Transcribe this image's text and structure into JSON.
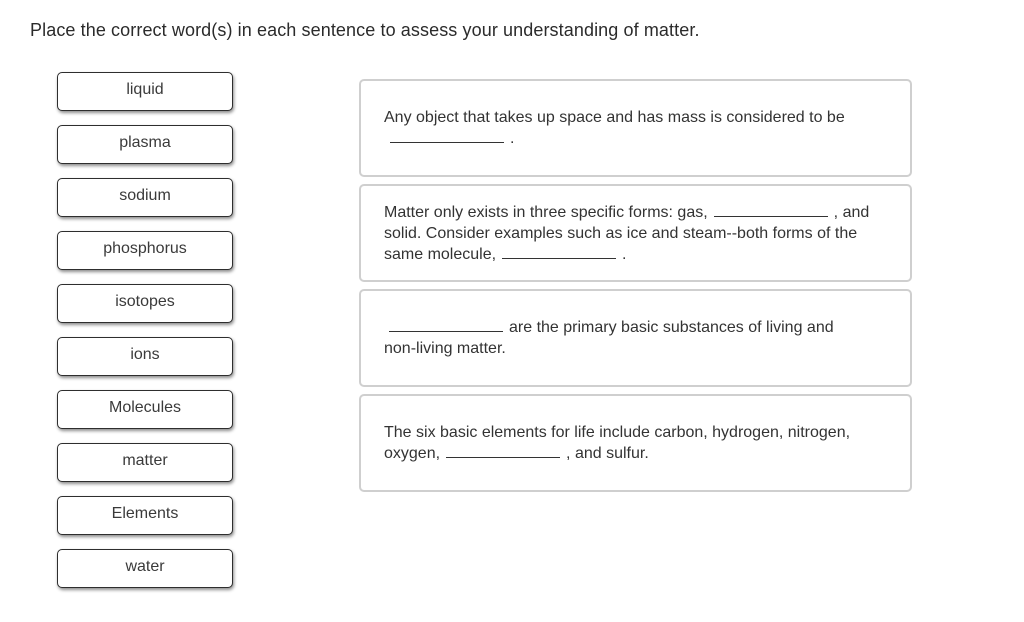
{
  "instructions": "Place the correct word(s) in each sentence to assess your understanding of matter.",
  "word_bank": [
    {
      "label": "liquid"
    },
    {
      "label": "plasma"
    },
    {
      "label": "sodium"
    },
    {
      "label": "phosphorus"
    },
    {
      "label": "isotopes"
    },
    {
      "label": "ions"
    },
    {
      "label": "Molecules"
    },
    {
      "label": "matter"
    },
    {
      "label": "Elements"
    },
    {
      "label": "water"
    }
  ],
  "sentences": [
    {
      "parts": [
        "Any object that takes up space and has mass is considered to be",
        "."
      ]
    },
    {
      "parts": [
        "Matter only exists in three specific forms: gas,",
        ", and solid. Consider examples such as ice and steam--both forms of the same molecule,",
        "."
      ]
    },
    {
      "parts": [
        "",
        "are the primary basic substances of living and non-living matter."
      ]
    },
    {
      "parts": [
        "The six basic elements for life include carbon, hydrogen, nitrogen, oxygen,",
        ", and sulfur."
      ]
    }
  ]
}
